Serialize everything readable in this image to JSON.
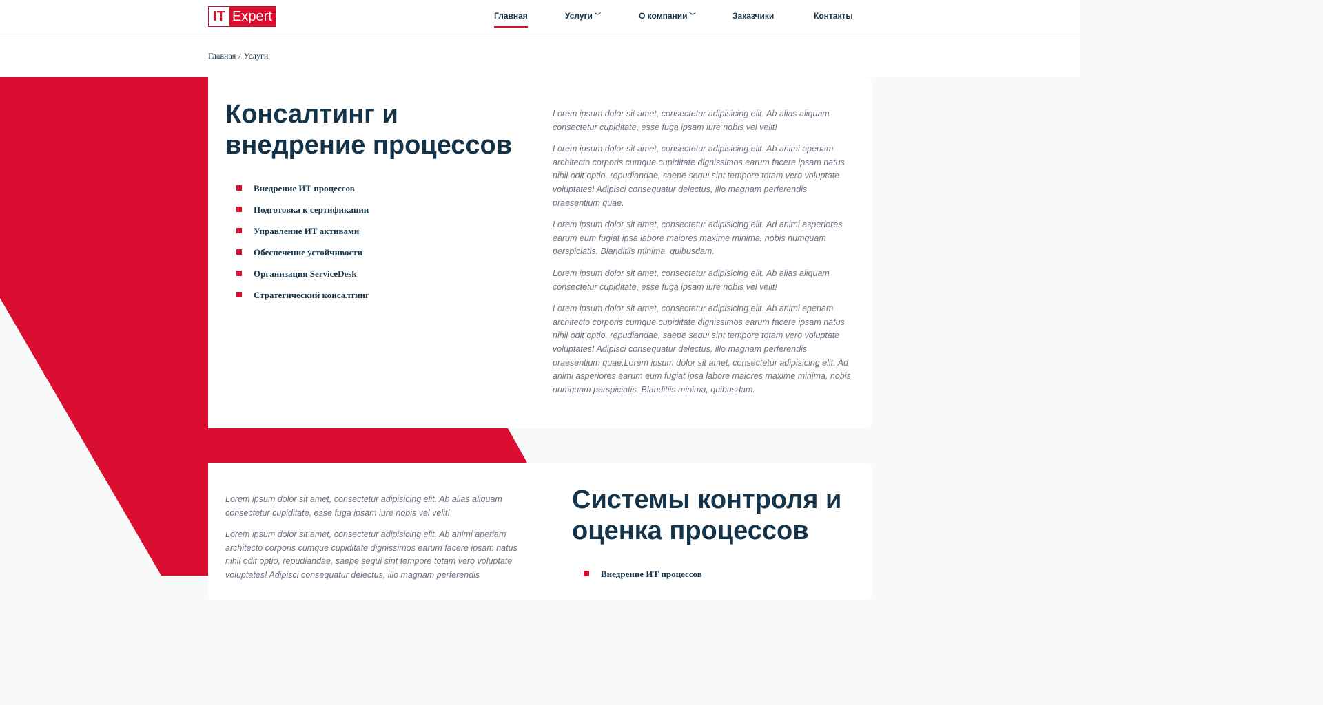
{
  "logo": {
    "part1": "IT",
    "part2": "Expert"
  },
  "nav": {
    "items": [
      {
        "label": "Главная"
      },
      {
        "label": "Услуги"
      },
      {
        "label": "О компании"
      },
      {
        "label": "Заказчики"
      },
      {
        "label": "Контакты"
      }
    ],
    "dropdown_icon": "chevron-down-icon"
  },
  "breadcrumb": {
    "home": "Главная",
    "separator": "/",
    "current": "Услуги"
  },
  "colors": {
    "accent": "#da0e30",
    "heading": "#15344a",
    "body_text": "#6b7280"
  },
  "sections": [
    {
      "title": "Консалтинг и внедрение процессов",
      "items": [
        "Внедрение ИТ процессов",
        "Подготовка к сертификации",
        "Управление ИТ активами",
        "Обеспечение устойчивости",
        "Организация ServiceDesk",
        "Стратегический консалтинг"
      ],
      "paragraphs": [
        "Lorem ipsum dolor sit amet, consectetur adipisicing elit. Ab alias aliquam consectetur cupiditate, esse fuga ipsam iure nobis vel velit!",
        "Lorem ipsum dolor sit amet, consectetur adipisicing elit. Ab animi aperiam architecto corporis cumque cupiditate dignissimos earum facere ipsam natus nihil odit optio, repudiandae, saepe sequi sint tempore totam vero voluptate voluptates! Adipisci consequatur delectus, illo magnam perferendis praesentium quae.",
        "Lorem ipsum dolor sit amet, consectetur adipisicing elit. Ad animi asperiores earum eum fugiat ipsa labore maiores maxime minima, nobis numquam perspiciatis. Blanditiis minima, quibusdam.",
        "Lorem ipsum dolor sit amet, consectetur adipisicing elit. Ab alias aliquam consectetur cupiditate, esse fuga ipsam iure nobis vel velit!",
        "Lorem ipsum dolor sit amet, consectetur adipisicing elit. Ab animi aperiam architecto corporis cumque cupiditate dignissimos earum facere ipsam natus nihil odit optio, repudiandae, saepe sequi sint tempore totam vero voluptate voluptates! Adipisci consequatur delectus, illo magnam perferendis praesentium quae.Lorem ipsum dolor sit amet, consectetur adipisicing elit. Ad animi asperiores earum eum fugiat ipsa labore maiores maxime minima, nobis numquam perspiciatis. Blanditiis minima, quibusdam."
      ]
    },
    {
      "title": "Системы контроля и оценка процессов",
      "items": [
        "Внедрение ИТ процессов"
      ],
      "paragraphs": [
        "Lorem ipsum dolor sit amet, consectetur adipisicing elit. Ab alias aliquam consectetur cupiditate, esse fuga ipsam iure nobis vel velit!",
        "Lorem ipsum dolor sit amet, consectetur adipisicing elit. Ab animi aperiam architecto corporis cumque cupiditate dignissimos earum facere ipsam natus nihil odit optio, repudiandae, saepe sequi sint tempore totam vero voluptate voluptates! Adipisci consequatur delectus, illo magnam perferendis"
      ]
    }
  ]
}
